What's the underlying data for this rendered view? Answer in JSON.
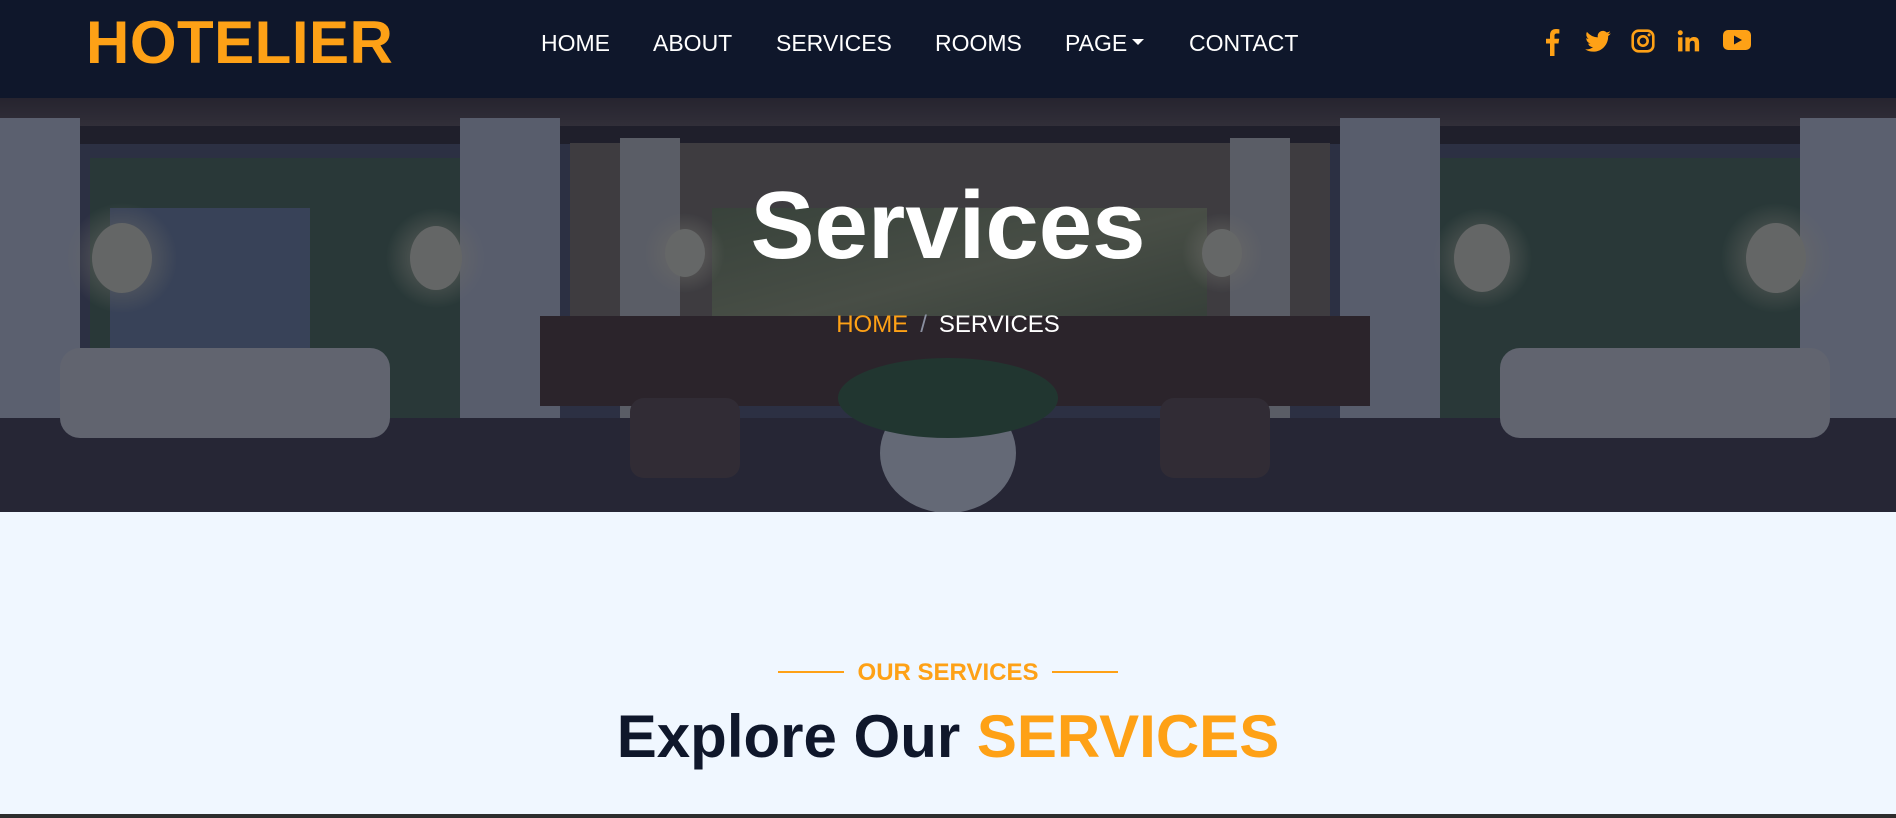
{
  "brand": {
    "name": "HOTELIER",
    "color": "#fea116"
  },
  "nav": {
    "items": [
      {
        "label": "HOME"
      },
      {
        "label": "ABOUT"
      },
      {
        "label": "SERVICES"
      },
      {
        "label": "ROOMS"
      },
      {
        "label": "PAGE",
        "dropdown": true
      },
      {
        "label": "CONTACT"
      }
    ]
  },
  "social": {
    "icons": [
      "facebook-icon",
      "twitter-icon",
      "instagram-icon",
      "linkedin-icon",
      "youtube-icon"
    ]
  },
  "hero": {
    "title": "Services",
    "breadcrumb": {
      "home": "HOME",
      "separator": "/",
      "current": "SERVICES"
    }
  },
  "services_section": {
    "subtitle": "OUR SERVICES",
    "title_main": "Explore Our",
    "title_accent": "SERVICES"
  },
  "colors": {
    "navbar": "#0f172b",
    "accent": "#fea116",
    "section_bg": "#f0f7ff"
  }
}
